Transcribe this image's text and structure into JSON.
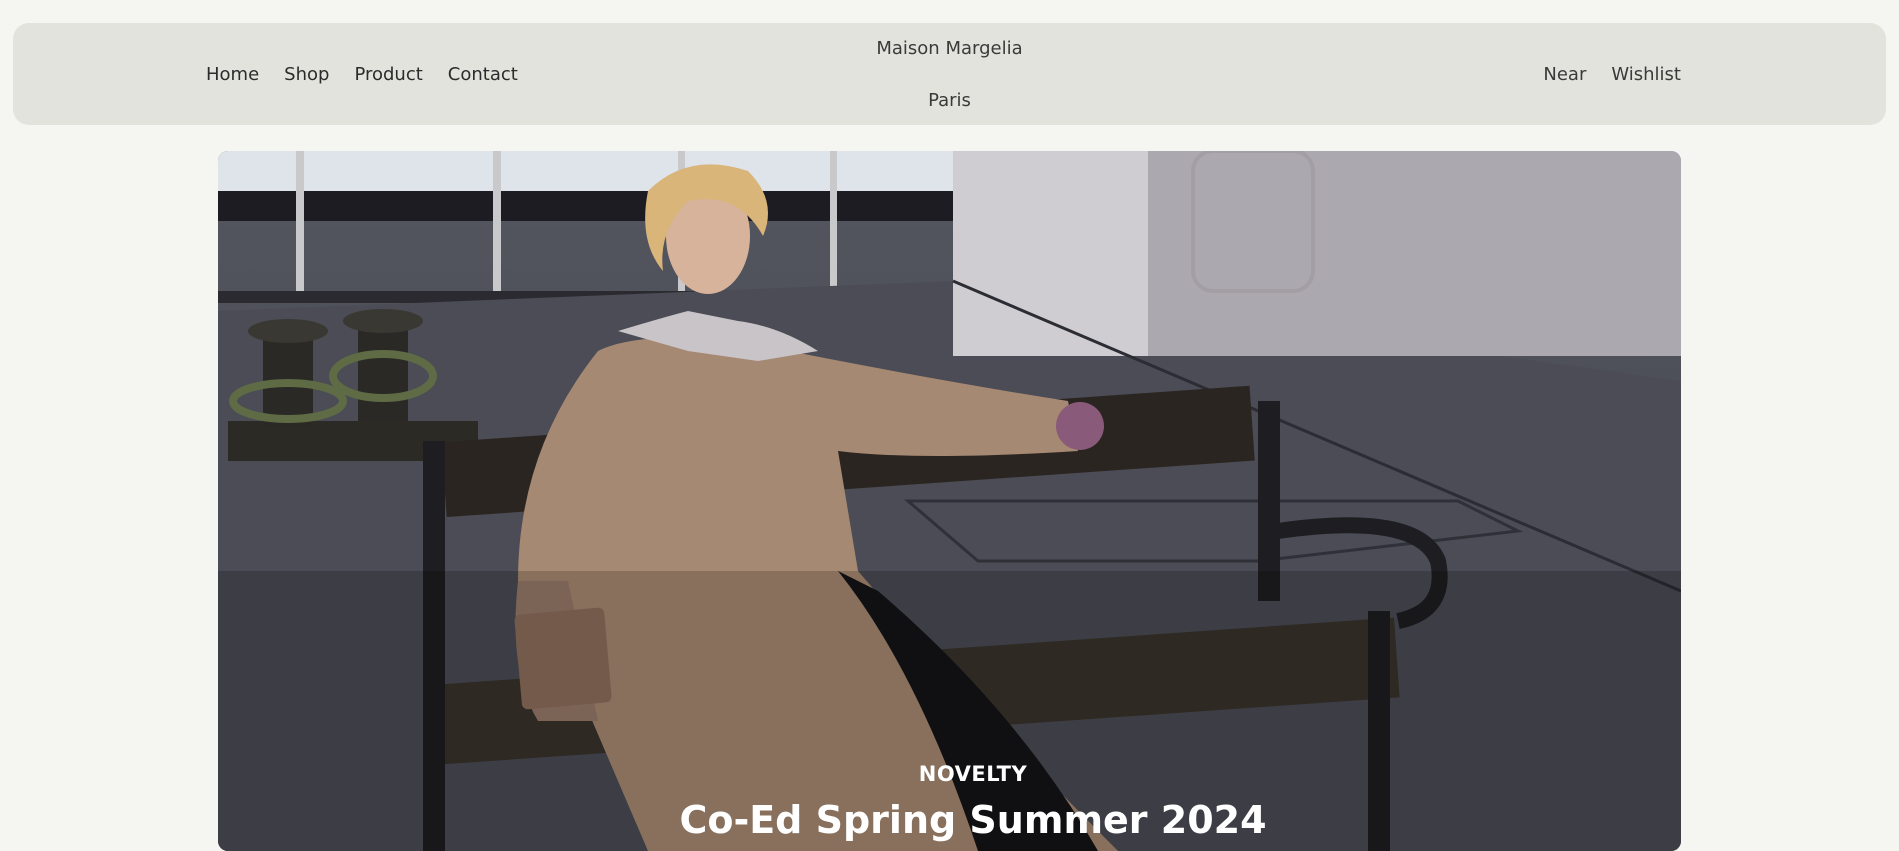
{
  "nav": {
    "left_links": [
      "Home",
      "Shop",
      "Product",
      "Contact"
    ],
    "brand_line1": "Maison Margelia",
    "brand_line2": "Paris",
    "right_links": [
      "Near",
      "Wishlist"
    ]
  },
  "hero": {
    "eyebrow": "NOVELTY",
    "headline": "Co-Ed Spring Summer 2024",
    "image_alt": "Model in beige trench coat seated on a wooden bench on a ship deck"
  },
  "colors": {
    "page_bg": "#f5f6f1",
    "nav_bg": "#e3e3de",
    "text": "#2b2b2b"
  }
}
